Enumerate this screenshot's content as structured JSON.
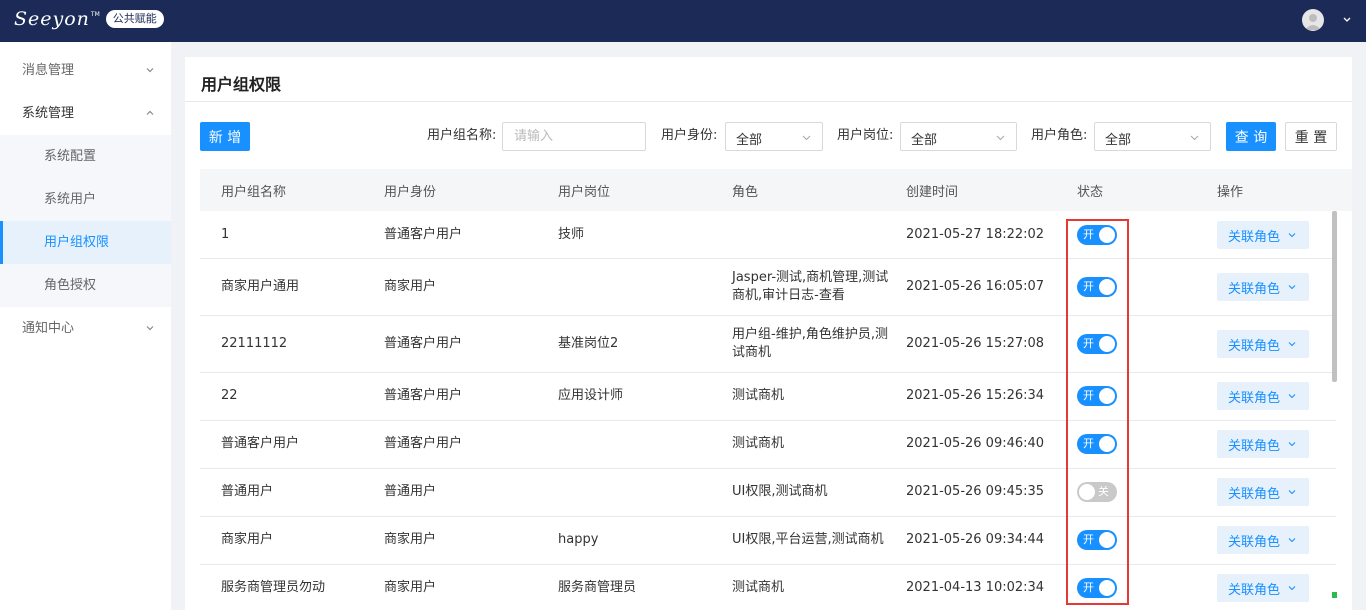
{
  "header": {
    "logo_text": "Seeyon",
    "logo_tm": "TM",
    "badge": "公共赋能"
  },
  "sidebar": {
    "items": [
      {
        "label": "消息管理"
      },
      {
        "label": "系统管理"
      },
      {
        "label": "系统配置"
      },
      {
        "label": "系统用户"
      },
      {
        "label": "用户组权限"
      },
      {
        "label": "角色授权"
      },
      {
        "label": "通知中心"
      }
    ]
  },
  "page": {
    "title": "用户组权限",
    "add_label": "新 增",
    "query_label": "查 询",
    "reset_label": "重 置"
  },
  "filters": {
    "name_label": "用户组名称:",
    "name_placeholder": "请输入",
    "identity_label": "用户身份:",
    "identity_value": "全部",
    "post_label": "用户岗位:",
    "post_value": "全部",
    "role_label": "用户角色:",
    "role_value": "全部"
  },
  "table": {
    "columns": [
      "用户组名称",
      "用户身份",
      "用户岗位",
      "角色",
      "创建时间",
      "状态",
      "操作"
    ],
    "action_label": "关联角色",
    "rows": [
      {
        "name": "1",
        "identity": "普通客户用户",
        "post": "技师",
        "role1": "",
        "role2": "",
        "time": "2021-05-27 18:22:02",
        "on": true,
        "status": "开"
      },
      {
        "name": "商家用户通用",
        "identity": "商家用户",
        "post": "",
        "role1": "Jasper-测试,商机管理,测试",
        "role2": "商机,审计日志-查看",
        "time": "2021-05-26 16:05:07",
        "on": true,
        "status": "开"
      },
      {
        "name": "22111112",
        "identity": "普通客户用户",
        "post": "基准岗位2",
        "role1": "用户组-维护,角色维护员,测",
        "role2": "试商机",
        "time": "2021-05-26 15:27:08",
        "on": true,
        "status": "开"
      },
      {
        "name": "22",
        "identity": "普通客户用户",
        "post": "应用设计师",
        "role1": "测试商机",
        "role2": "",
        "time": "2021-05-26 15:26:34",
        "on": true,
        "status": "开"
      },
      {
        "name": "普通客户用户",
        "identity": "普通客户用户",
        "post": "",
        "role1": "测试商机",
        "role2": "",
        "time": "2021-05-26 09:46:40",
        "on": true,
        "status": "开"
      },
      {
        "name": "普通用户",
        "identity": "普通用户",
        "post": "",
        "role1": "UI权限,测试商机",
        "role2": "",
        "time": "2021-05-26 09:45:35",
        "on": false,
        "status": "关"
      },
      {
        "name": "商家用户",
        "identity": "商家用户",
        "post": "happy",
        "role1": "UI权限,平台运营,测试商机",
        "role2": "",
        "time": "2021-05-26 09:34:44",
        "on": true,
        "status": "开"
      },
      {
        "name": "服务商管理员勿动",
        "identity": "商家用户",
        "post": "服务商管理员",
        "role1": "测试商机",
        "role2": "",
        "time": "2021-04-13 10:02:34",
        "on": true,
        "status": "开"
      }
    ]
  }
}
